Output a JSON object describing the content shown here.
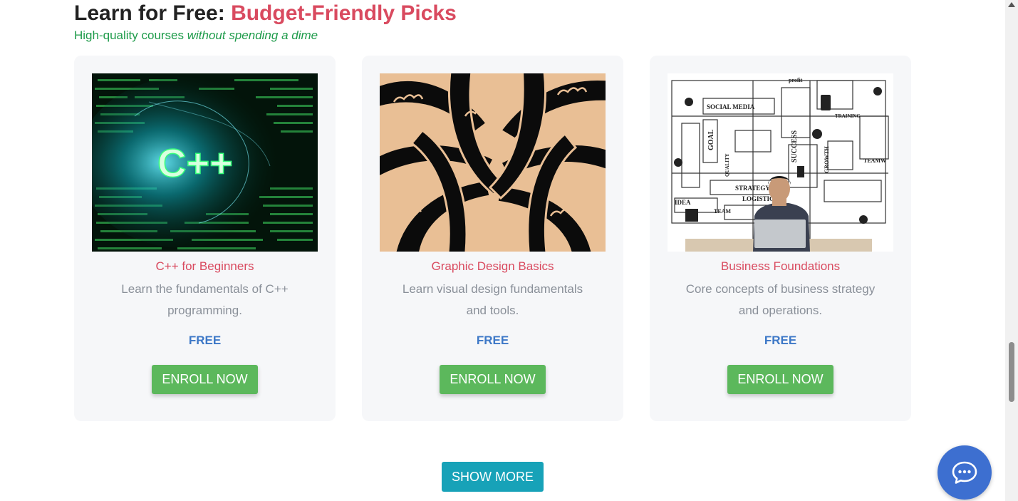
{
  "section": {
    "title_prefix": "Learn for Free:",
    "title_accent": "Budget-Friendly Picks",
    "subtitle_plain": "High-quality courses",
    "subtitle_italic": "without spending a dime"
  },
  "courses": [
    {
      "image_text": "C++",
      "title": "C++ for Beginners",
      "description": "Learn the fundamentals of C++ programming.",
      "price": "FREE",
      "button": "ENROLL NOW"
    },
    {
      "title": "Graphic Design Basics",
      "description": "Learn visual design fundamentals and tools.",
      "price": "FREE",
      "button": "ENROLL NOW"
    },
    {
      "image_text": {
        "social": "SOCIAL MEDIA",
        "goal": "GOAL",
        "success": "SUCCESS",
        "strategy": "STRATEGY",
        "logistics": "LOGISTICS",
        "idea": "IDEA",
        "team": "TEAM",
        "profit": "profit",
        "training": "TRAINING",
        "teamwork": "TEAMW",
        "growth": "GROWTH",
        "quality": "QUALITY"
      },
      "title": "Business Foundations",
      "description": "Core concepts of business strategy and operations.",
      "price": "FREE",
      "button": "ENROLL NOW"
    }
  ],
  "show_more": "SHOW MORE",
  "colors": {
    "accent": "#d94a5f",
    "subtitle": "#1e9b4a",
    "price": "#3d78c7",
    "enroll": "#5cb85c",
    "show_more": "#17a2b8",
    "chat": "#3d6fd0",
    "card_bg": "#f6f7f9"
  },
  "icons": [
    "chat-bubble-icon",
    "scroll-up-arrow-icon"
  ]
}
